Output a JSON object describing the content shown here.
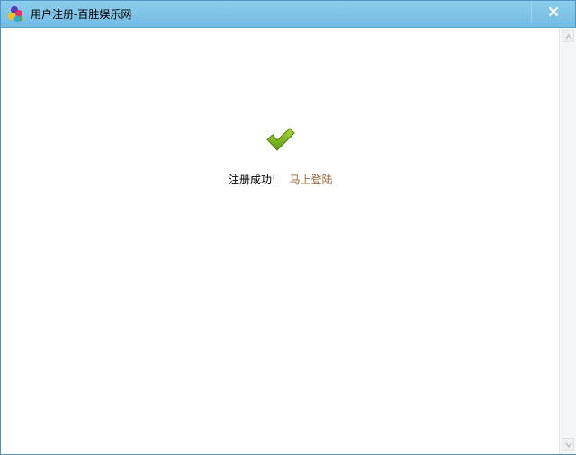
{
  "window": {
    "title": "用户注册-百胜娱乐网",
    "app_icon": "colorful-butterfly-icon",
    "close_icon": "close-icon",
    "titlebar_color": "#7fc4e7"
  },
  "content": {
    "status_icon": "checkmark-icon",
    "success_message": "注册成功!",
    "login_link": "马上登陆",
    "link_color": "#9a6a38",
    "check_color": "#7bb21a"
  },
  "scrollbar": {
    "up_icon": "scroll-up-arrow-icon",
    "down_icon": "scroll-down-arrow-icon"
  }
}
